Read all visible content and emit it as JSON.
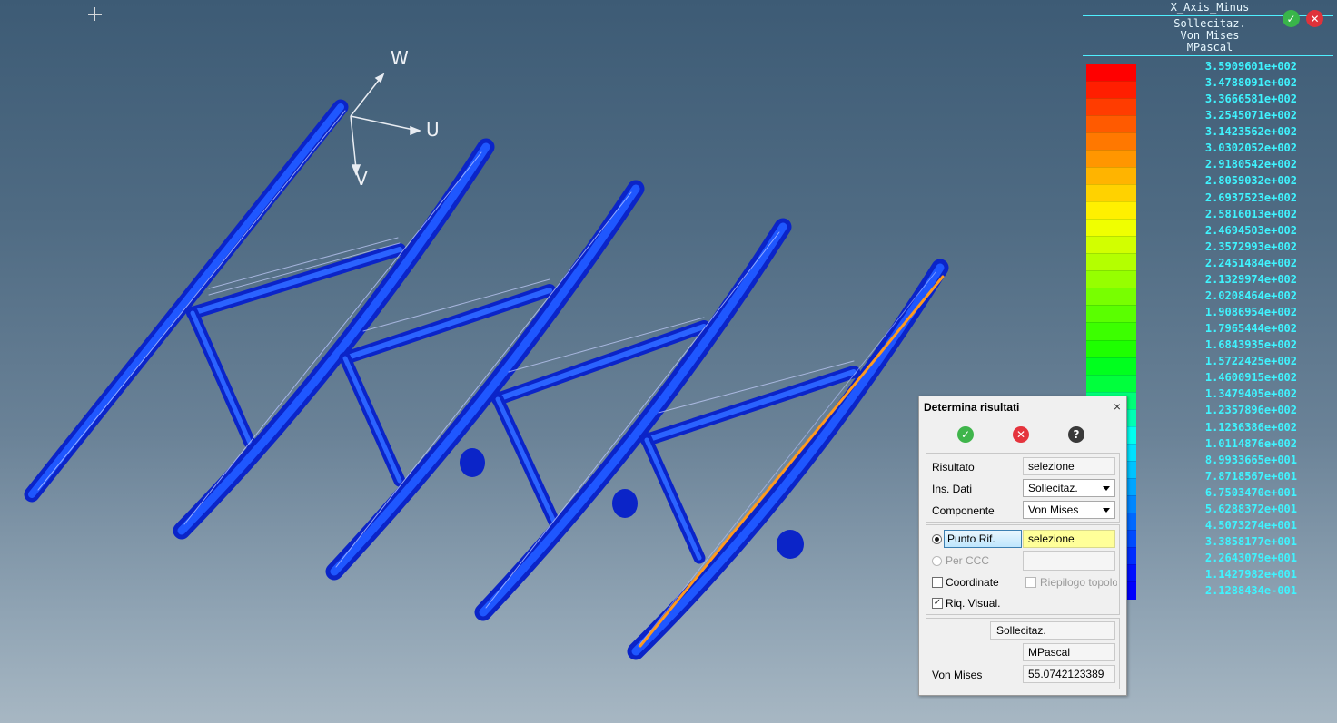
{
  "legend": {
    "title": "X_Axis_Minus",
    "quantity": "Sollecitaz.",
    "component": "Von Mises",
    "unit": "MPascal",
    "values": [
      "3.5909601e+002",
      "3.4788091e+002",
      "3.3666581e+002",
      "3.2545071e+002",
      "3.1423562e+002",
      "3.0302052e+002",
      "2.9180542e+002",
      "2.8059032e+002",
      "2.6937523e+002",
      "2.5816013e+002",
      "2.4694503e+002",
      "2.3572993e+002",
      "2.2451484e+002",
      "2.1329974e+002",
      "2.0208464e+002",
      "1.9086954e+002",
      "1.7965444e+002",
      "1.6843935e+002",
      "1.5722425e+002",
      "1.4600915e+002",
      "1.3479405e+002",
      "1.2357896e+002",
      "1.1236386e+002",
      "1.0114876e+002",
      "8.9933665e+001",
      "7.8718567e+001",
      "6.7503470e+001",
      "5.6288372e+001",
      "4.5073274e+001",
      "3.3858177e+001",
      "2.2643079e+001",
      "1.1427982e+001",
      "2.1288434e-001"
    ],
    "colors": [
      "#ff0000",
      "#ff1e00",
      "#ff3c00",
      "#ff5a00",
      "#ff7800",
      "#ff9600",
      "#ffb400",
      "#ffd200",
      "#fff000",
      "#f0ff00",
      "#d2ff00",
      "#b4ff00",
      "#96ff00",
      "#78ff00",
      "#5aff00",
      "#3cff00",
      "#1eff00",
      "#00ff1e",
      "#00ff3c",
      "#00ff78",
      "#00ffb4",
      "#00fff0",
      "#00e1ff",
      "#00c3ff",
      "#00a5ff",
      "#0087ff",
      "#0069ff",
      "#004bff",
      "#002dff",
      "#000fff",
      "#0000ff"
    ]
  },
  "axes": {
    "w": "W",
    "u": "U",
    "v": "V"
  },
  "dialog": {
    "title": "Determina risultati",
    "close": "×",
    "risultato_label": "Risultato",
    "risultato_value": "selezione",
    "ins_dati_label": "Ins. Dati",
    "ins_dati_value": "Sollecitaz.",
    "componente_label": "Componente",
    "componente_value": "Von Mises",
    "punto_rif_label": "Punto Rif.",
    "punto_rif_value": "selezione",
    "per_ccc_label": "Per CCC",
    "coordinate_label": "Coordinate",
    "riepilogo_label": "Riepilogo topolo",
    "riq_visual_label": "Riq. Visual.",
    "riq_visual_check": "✓",
    "result_quantity": "Sollecitaz.",
    "result_unit": "MPascal",
    "result_label": "Von Mises",
    "result_value": "55.0742123389"
  },
  "icons": {
    "ok": "✓",
    "cancel": "✕",
    "help": "?"
  }
}
